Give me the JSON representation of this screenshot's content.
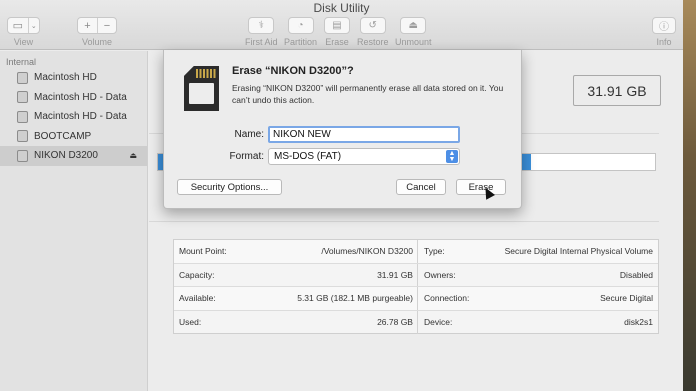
{
  "window": {
    "title": "Disk Utility"
  },
  "toolbar": {
    "view_label": "View",
    "volume_label": "Volume",
    "volume_add": "+",
    "volume_remove": "−",
    "first_aid_label": "First Aid",
    "partition_label": "Partition",
    "erase_label": "Erase",
    "restore_label": "Restore",
    "unmount_label": "Unmount",
    "info_label": "Info"
  },
  "sidebar": {
    "header": "Internal",
    "items": [
      {
        "label": "Macintosh HD"
      },
      {
        "label": "Macintosh HD - Data"
      },
      {
        "label": "Macintosh HD - Data"
      },
      {
        "label": "BOOTCAMP"
      },
      {
        "label": "NIKON D3200",
        "selected": true,
        "eject": "⏏"
      }
    ]
  },
  "main": {
    "capacity": "31.91 GB",
    "usage_fraction": 0.75,
    "usage_color": "#3a8fd9",
    "info": [
      {
        "left_key": "Mount Point:",
        "left_val": "/Volumes/NIKON D3200",
        "right_key": "Type:",
        "right_val": "Secure Digital Internal Physical Volume"
      },
      {
        "left_key": "Capacity:",
        "left_val": "31.91 GB",
        "right_key": "Owners:",
        "right_val": "Disabled"
      },
      {
        "left_key": "Available:",
        "left_val": "5.31 GB (182.1 MB purgeable)",
        "right_key": "Connection:",
        "right_val": "Secure Digital"
      },
      {
        "left_key": "Used:",
        "left_val": "26.78 GB",
        "right_key": "Device:",
        "right_val": "disk2s1"
      }
    ]
  },
  "dialog": {
    "title": "Erase “NIKON D3200”?",
    "message": "Erasing “NIKON D3200” will permanently erase all data stored on it. You can’t undo this action.",
    "name_label": "Name:",
    "name_value": "NIKON NEW",
    "format_label": "Format:",
    "format_value": "MS-DOS (FAT)",
    "security_button": "Security Options...",
    "cancel_button": "Cancel",
    "erase_button": "Erase"
  }
}
